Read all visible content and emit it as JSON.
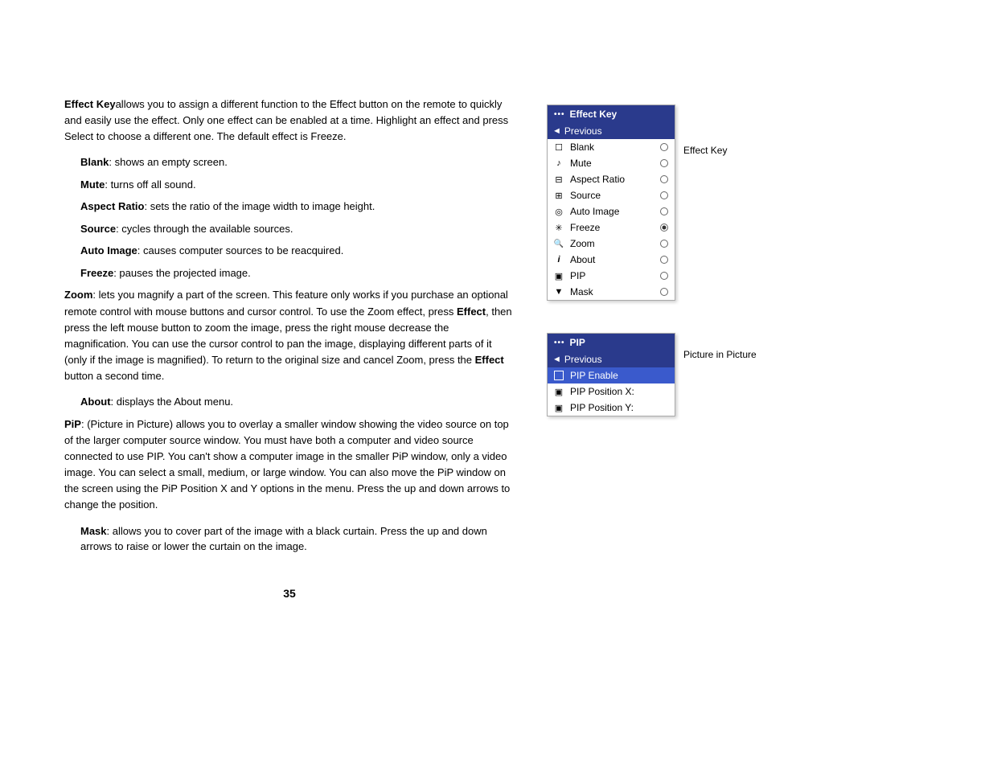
{
  "page": {
    "number": "35"
  },
  "left_content": {
    "para1": "allows you to assign a different function to the Effect button on the remote to quickly and easily use the effect. Only one effect can be enabled at a time. Highlight an effect and press Select to choose a different one. The default effect is Freeze.",
    "effect_key_label": "Effect Key",
    "blank_label": "Blank",
    "blank_desc": ": shows an empty screen.",
    "mute_label": "Mute",
    "mute_desc": ": turns off all sound.",
    "aspect_label": "Aspect Ratio",
    "aspect_desc": ": sets the ratio of the image width to image height.",
    "source_label": "Source",
    "source_desc": ": cycles through the available sources.",
    "auto_label": "Auto Image",
    "auto_desc": ": causes computer sources to be reacquired.",
    "freeze_label": "Freeze",
    "freeze_desc": ": pauses the projected image.",
    "zoom_label": "Zoom",
    "zoom_desc": ": lets you magnify a part of the screen. This feature only works if you purchase an optional remote control with mouse buttons and cursor control. To use the Zoom effect, press Effect, then press the left mouse button to zoom the image, press the right mouse decrease the magnification. You can use the cursor control to pan the image, displaying different parts of it (only if the image is magnified). To return to the original size and cancel Zoom, press the Effect button a second time.",
    "about_label": "About",
    "about_desc": ": displays the About menu.",
    "pip_label": "PiP",
    "pip_desc": ": (Picture in Picture) allows you to overlay a smaller window showing the video source on top of the larger computer source window. You must have both a computer and video source connected to use PIP. You can’t show a computer image in the smaller PiP window, only a video image. You can select a small, medium, or large window. You can also move the PiP window on the screen using the PiP Position X and Y options in the menu. Press the up and down arrows to change the position.",
    "mask_label": "Mask",
    "mask_desc": ": allows you to cover part of the image with a black curtain. Press the up and down arrows to raise or lower the curtain on the image."
  },
  "effect_key_menu": {
    "title": "Effect Key",
    "dots": "•••",
    "previous": "Previous",
    "items": [
      {
        "id": "blank",
        "label": "Blank",
        "icon": "☐",
        "radio": false
      },
      {
        "id": "mute",
        "label": "Mute",
        "icon": "🔇",
        "radio": false
      },
      {
        "id": "aspect",
        "label": "Aspect Ratio",
        "icon": "⊟",
        "radio": false
      },
      {
        "id": "source",
        "label": "Source",
        "icon": "⊞",
        "radio": false
      },
      {
        "id": "autoimage",
        "label": "Auto Image",
        "icon": "◎",
        "radio": false
      },
      {
        "id": "freeze",
        "label": "Freeze",
        "icon": "✳",
        "radio": true
      },
      {
        "id": "zoom",
        "label": "Zoom",
        "icon": "🔍",
        "radio": false
      },
      {
        "id": "about",
        "label": "About",
        "icon": "ℹ",
        "radio": false
      },
      {
        "id": "pip",
        "label": "PIP",
        "icon": "▣",
        "radio": false
      },
      {
        "id": "mask",
        "label": "Mask",
        "icon": "▼",
        "radio": false
      }
    ],
    "side_label": "Effect Key"
  },
  "pip_menu": {
    "title": "PIP",
    "dots": "•••",
    "previous": "Previous",
    "items": [
      {
        "id": "pip-enable",
        "label": "PIP Enable",
        "icon": "checkbox",
        "selected": true
      },
      {
        "id": "pip-pos-x",
        "label": "PIP Position X:",
        "icon": "monitor"
      },
      {
        "id": "pip-pos-y",
        "label": "PIP Position Y:",
        "icon": "monitor"
      }
    ],
    "side_label": "Picture in Picture"
  }
}
